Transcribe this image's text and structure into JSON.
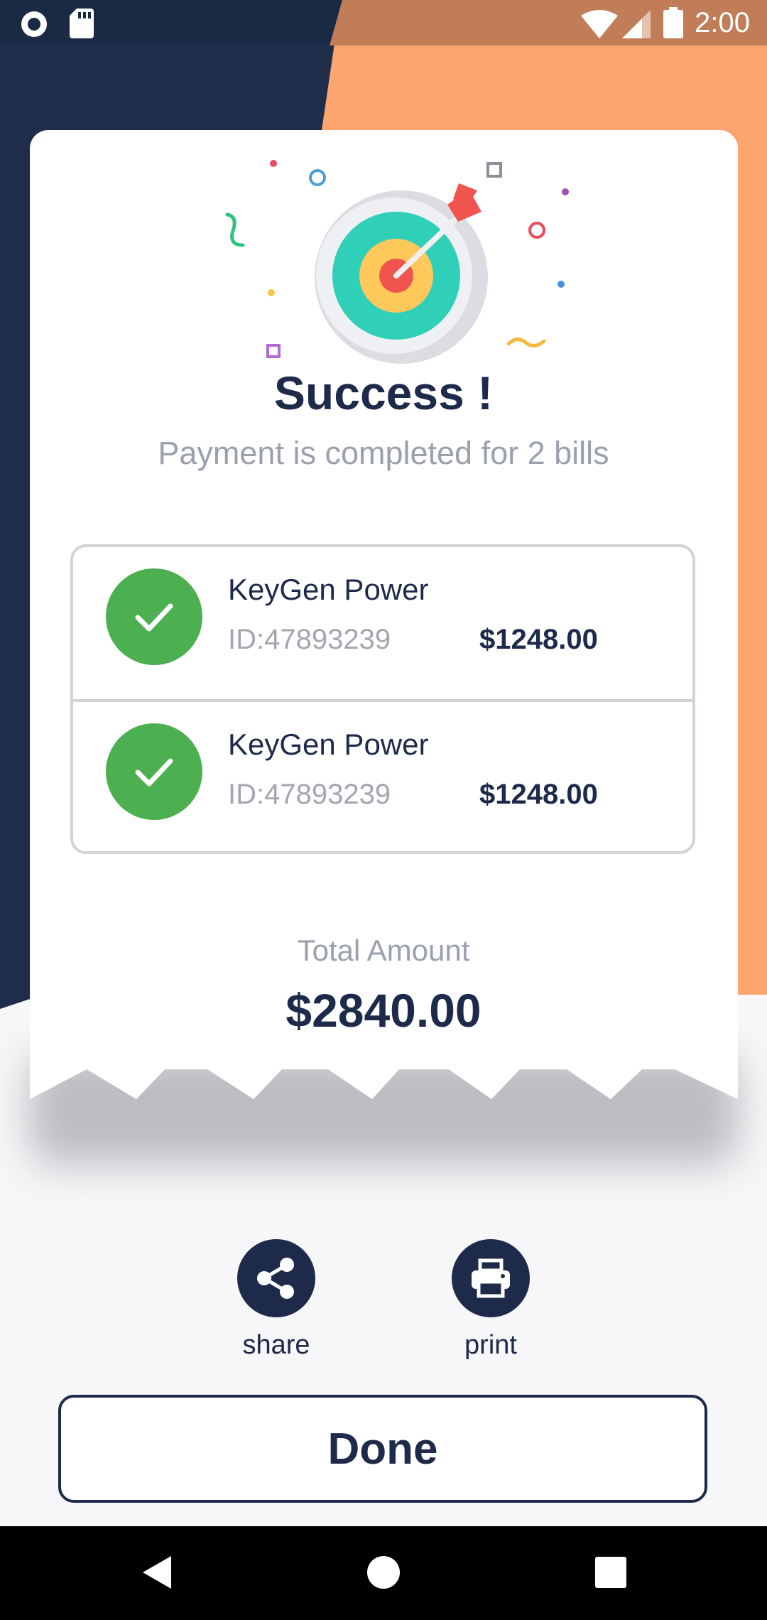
{
  "status_bar": {
    "time": "2:00",
    "icons": [
      "record-icon",
      "sd-card-icon",
      "wifi-icon",
      "signal-icon",
      "battery-icon"
    ]
  },
  "illustration": {
    "icon": "target-dart-icon"
  },
  "header": {
    "title": "Success !",
    "subtitle": "Payment is completed for 2 bills"
  },
  "bills": [
    {
      "name": "KeyGen Power",
      "id": "ID:47893239",
      "amount": "$1248.00",
      "status_icon": "check-icon"
    },
    {
      "name": "KeyGen Power",
      "id": "ID:47893239",
      "amount": "$1248.00",
      "status_icon": "check-icon"
    }
  ],
  "total": {
    "label": "Total Amount",
    "value": "$2840.00"
  },
  "actions": {
    "share_label": "share",
    "print_label": "print"
  },
  "done_label": "Done",
  "colors": {
    "navy": "#1d2a4a",
    "orange": "#fda56f",
    "success_green": "#4caf50",
    "muted_text": "#9aa0ac"
  },
  "nav": {
    "buttons": [
      "back-icon",
      "home-icon",
      "recents-icon"
    ]
  }
}
